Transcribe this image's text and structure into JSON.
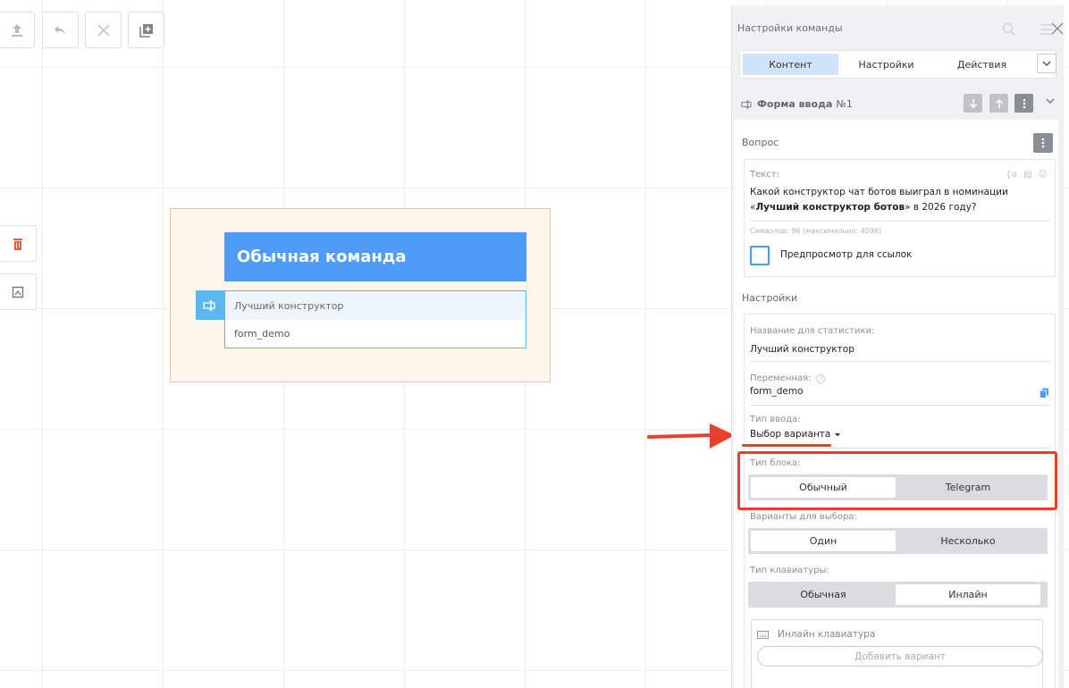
{
  "toolbar": {
    "icons": [
      "upload-icon",
      "undo-icon",
      "close-icon",
      "add-block-icon"
    ]
  },
  "side_tools": [
    "trash-icon",
    "frame-icon"
  ],
  "node": {
    "title": "Обычная команда",
    "row_label": "Лучший конструктор",
    "row_variable": "form_demo"
  },
  "panel": {
    "title": "Настройки команды",
    "tabs": [
      "Контент",
      "Настройки",
      "Действия"
    ],
    "active_tab": "Контент",
    "component": {
      "name": "Форма ввода",
      "number": "№1"
    },
    "question": {
      "section": "Вопрос",
      "text_label": "Текст:",
      "text_part1": "Какой конструктор чат ботов выиграл в номинации «",
      "text_bold": "Лучший конструктор ботов",
      "text_part2": "» в 2026 году?",
      "counter": "Символов: 96 (максимально: 4096)",
      "preview_label": "Предпросмотр для ссылок"
    },
    "settings": {
      "section": "Настройки",
      "stat_name_label": "Название для статистики:",
      "stat_name_value": "Лучший конструктор",
      "variable_label": "Переменная:",
      "variable_value": "form_demo",
      "input_type_label": "Тип ввода:",
      "input_type_value": "Выбор варианта",
      "block_type_label": "Тип блока:",
      "block_type_options": [
        "Обычный",
        "Telegram"
      ],
      "block_type_selected": "Обычный",
      "choice_label": "Варианты для выбора:",
      "choice_options": [
        "Один",
        "Несколько"
      ],
      "choice_selected": "Один",
      "keyboard_label": "Тип клавиатуры:",
      "keyboard_options": [
        "Обычная",
        "Инлайн"
      ],
      "keyboard_selected": "Инлайн",
      "inline_keyboard_label": "Инлайн клавиатура",
      "add_option_label": "Добавить вариант"
    }
  },
  "colors": {
    "accent": "#4f9bf8",
    "highlight": "#e8402c",
    "node_area": "#fdf6ea"
  }
}
